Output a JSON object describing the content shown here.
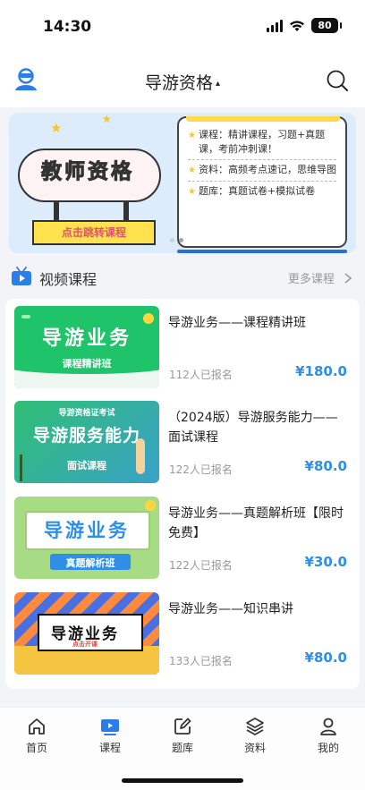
{
  "status_bar": {
    "time": "14:30",
    "battery": "80"
  },
  "nav": {
    "title": "导游资格",
    "caret": "▴"
  },
  "banner": {
    "headline": "教师资格",
    "sign_text": "点击跳转课程",
    "lines": [
      "课程：精讲课程，习题+真题课，考前冲刺课！",
      "资料：高频考点速记，思维导图",
      "题库：真题试卷+模拟试卷"
    ]
  },
  "section": {
    "title": "视频课程",
    "more": "更多课程"
  },
  "courses": [
    {
      "title": "导游业务——课程精讲班",
      "count": "112人已报名",
      "price": "¥180.0",
      "thumb_title": "导游业务",
      "thumb_sub": "课程精讲班",
      "thumb_top": ""
    },
    {
      "title": "（2024版）导游服务能力——面试课程",
      "count": "122人已报名",
      "price": "¥80.0",
      "thumb_title": "导游服务能力",
      "thumb_sub": "面试课程",
      "thumb_top": "导游资格证考试"
    },
    {
      "title": "导游业务——真题解析班【限时免费】",
      "count": "122人已报名",
      "price": "¥30.0",
      "thumb_title": "导游业务",
      "thumb_sub": "真题解析班",
      "thumb_top": ""
    },
    {
      "title": "导游业务——知识串讲",
      "count": "133人已报名",
      "price": "¥80.0",
      "thumb_title": "导游业务",
      "thumb_sub": "点击开课",
      "thumb_top": ""
    }
  ],
  "tabs": [
    {
      "label": "首页",
      "icon": "home-icon"
    },
    {
      "label": "课程",
      "icon": "video-course-icon"
    },
    {
      "label": "题库",
      "icon": "edit-icon"
    },
    {
      "label": "资料",
      "icon": "layers-icon"
    },
    {
      "label": "我的",
      "icon": "person-icon"
    }
  ],
  "colors": {
    "accent": "#2f8fe6",
    "tab_active": "#2b7de9"
  }
}
